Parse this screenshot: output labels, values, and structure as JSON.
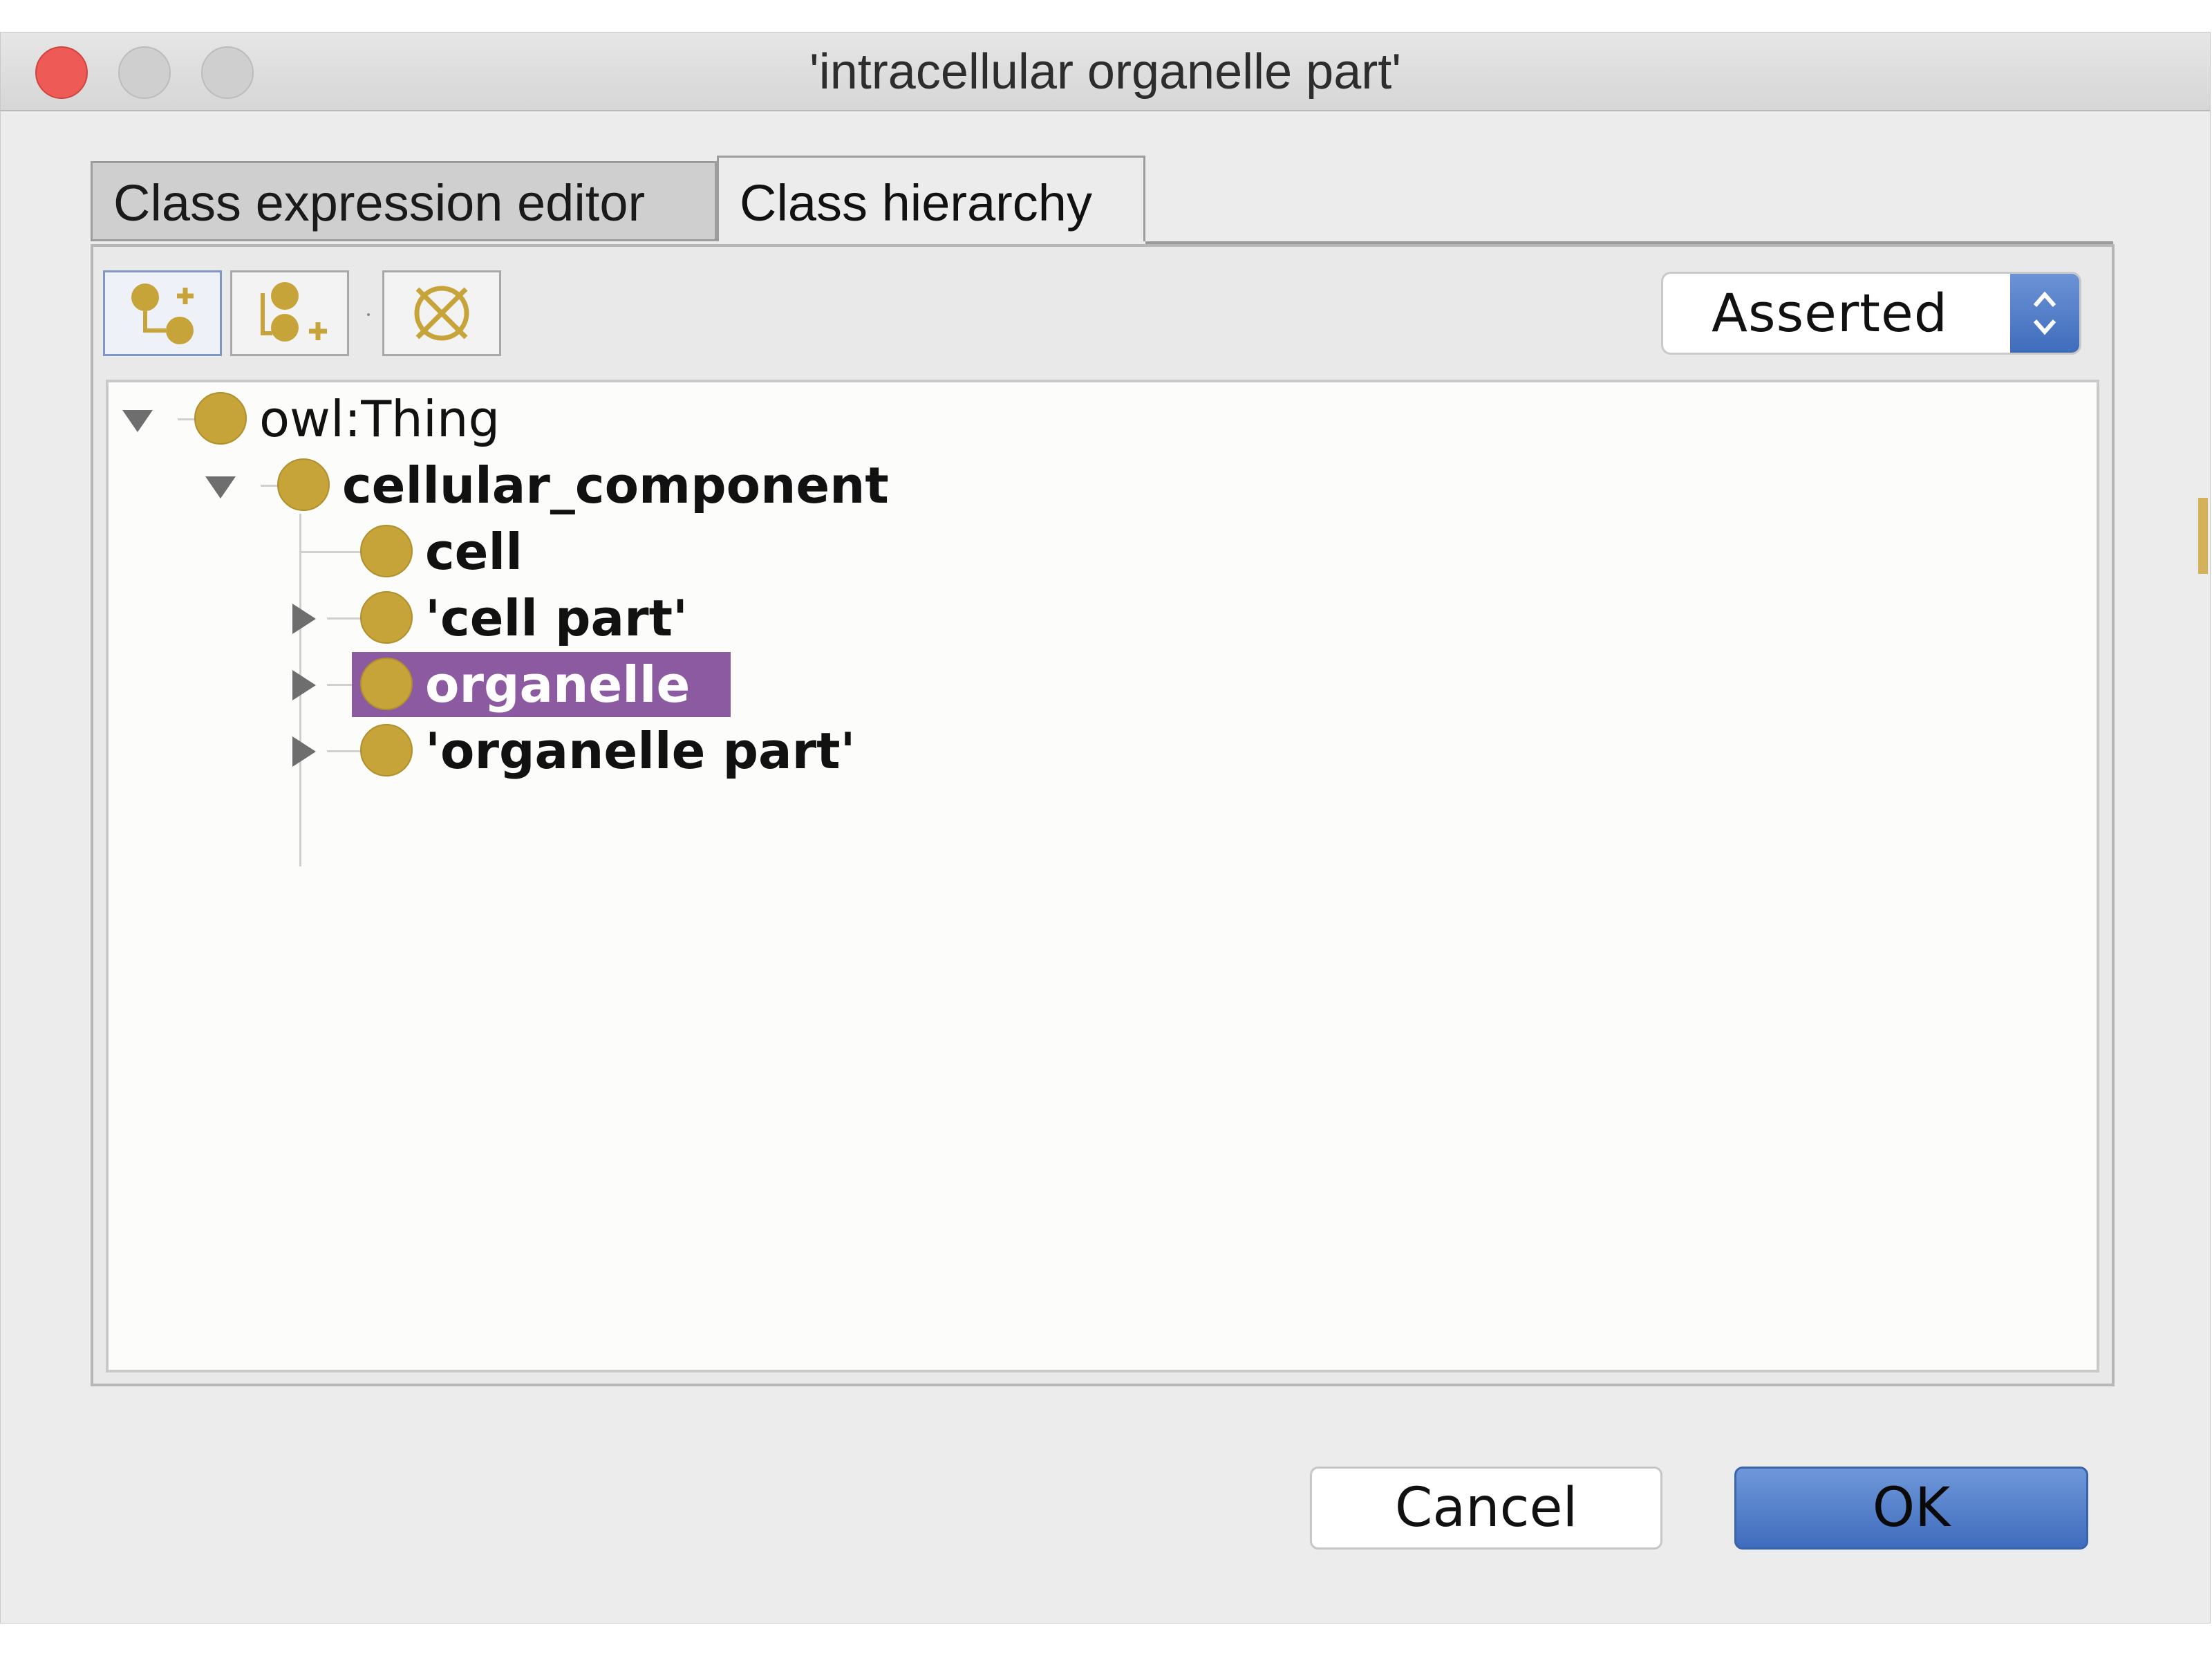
{
  "window": {
    "title": "'intracellular organelle part'"
  },
  "tabs": [
    {
      "label": "Class expression editor",
      "active": false
    },
    {
      "label": "Class hierarchy",
      "active": true
    }
  ],
  "toolbar": {
    "buttons": [
      {
        "icon": "add-subclass-icon"
      },
      {
        "icon": "add-sibling-icon"
      },
      {
        "icon": "delete-class-icon"
      }
    ],
    "view_mode": {
      "selected": "Asserted"
    }
  },
  "tree": {
    "items": [
      {
        "label": "owl:Thing",
        "bold": false,
        "expanded": true
      },
      {
        "label": "cellular_component",
        "bold": true,
        "expanded": true
      },
      {
        "label": "cell",
        "bold": true
      },
      {
        "label": "'cell part'",
        "bold": true,
        "expanded": false
      },
      {
        "label": "organelle",
        "bold": true,
        "expanded": false,
        "selected": true
      },
      {
        "label": "'organelle part'",
        "bold": true,
        "expanded": false
      }
    ]
  },
  "buttons": {
    "cancel": "Cancel",
    "ok": "OK"
  },
  "colors": {
    "class_dot": "#c6a43a",
    "selection": "#8c5aa0",
    "accent_blue": "#3f6cbd",
    "close": "#ee5a55"
  }
}
